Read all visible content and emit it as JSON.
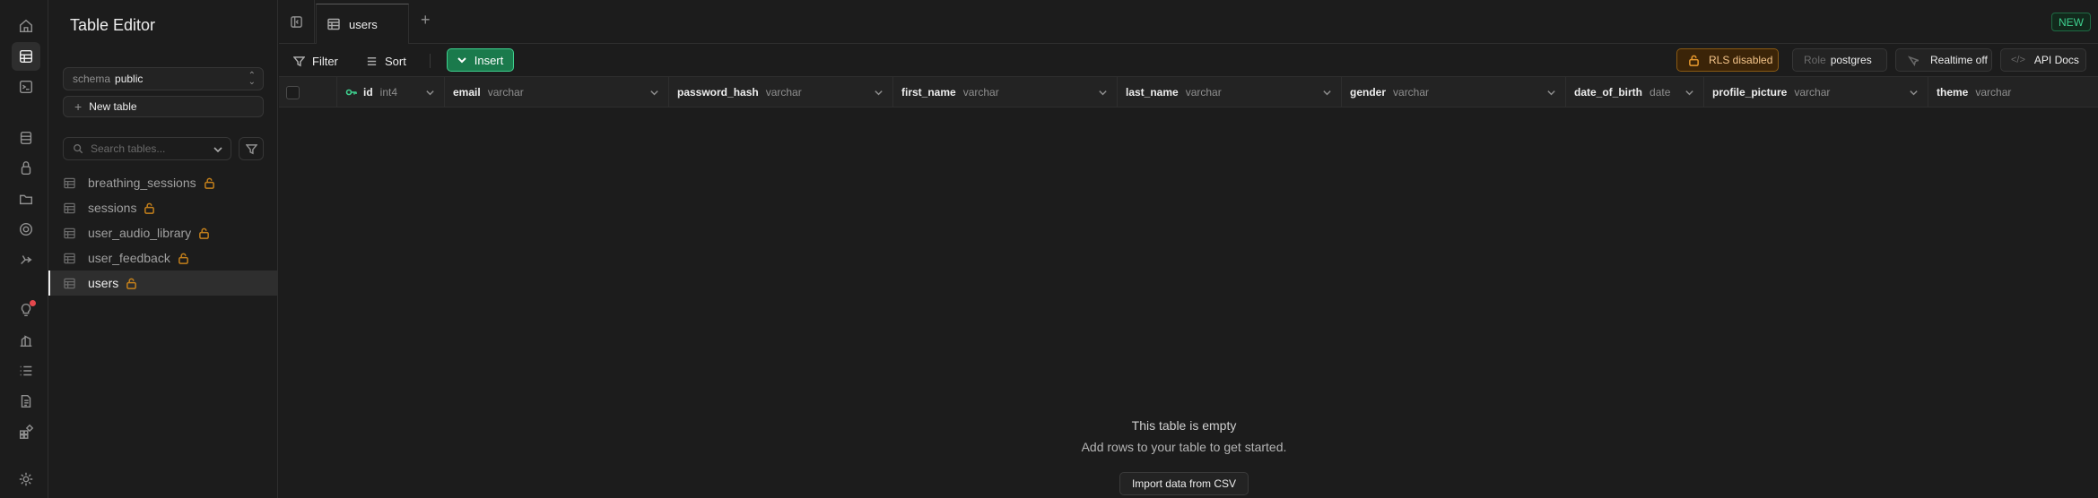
{
  "sidebar": {
    "title": "Table Editor",
    "schema": {
      "label": "schema",
      "value": "public"
    },
    "new_table_label": "New table",
    "search_placeholder": "Search tables...",
    "tables": [
      {
        "name": "breathing_sessions",
        "locked": true,
        "active": false
      },
      {
        "name": "sessions",
        "locked": true,
        "active": false
      },
      {
        "name": "user_audio_library",
        "locked": true,
        "active": false
      },
      {
        "name": "user_feedback",
        "locked": true,
        "active": false
      },
      {
        "name": "users",
        "locked": true,
        "active": true
      }
    ]
  },
  "tabs": [
    {
      "label": "users",
      "active": true
    }
  ],
  "new_badge": "NEW",
  "toolbar": {
    "filter_label": "Filter",
    "sort_label": "Sort",
    "insert_label": "Insert",
    "rls_label": "RLS disabled",
    "role_key": "Role",
    "role_value": "postgres",
    "realtime_label": "Realtime off",
    "api_docs_label": "API Docs"
  },
  "columns": [
    {
      "name": "id",
      "type": "int4",
      "primary_key": true
    },
    {
      "name": "email",
      "type": "varchar"
    },
    {
      "name": "password_hash",
      "type": "varchar"
    },
    {
      "name": "first_name",
      "type": "varchar"
    },
    {
      "name": "last_name",
      "type": "varchar"
    },
    {
      "name": "gender",
      "type": "varchar"
    },
    {
      "name": "date_of_birth",
      "type": "date"
    },
    {
      "name": "profile_picture",
      "type": "varchar"
    },
    {
      "name": "theme",
      "type": "varchar"
    }
  ],
  "empty_state": {
    "title": "This table is empty",
    "subtitle": "Add rows to your table to get started.",
    "import_label": "Import data from CSV"
  },
  "colors": {
    "background": "#1c1c1c",
    "accent_green": "#3ecf8e",
    "insert_bg": "#1a7a4c",
    "warning_amber": "#c4801b",
    "notification_red": "#e5484d"
  },
  "rail_icons": [
    "home-icon",
    "table-editor-icon",
    "sql-editor-icon",
    "database-icon",
    "auth-icon",
    "storage-icon",
    "realtime-icon",
    "edge-functions-icon",
    "advisors-icon",
    "reports-icon",
    "logs-icon",
    "api-docs-icon",
    "integrations-icon",
    "settings-icon"
  ]
}
